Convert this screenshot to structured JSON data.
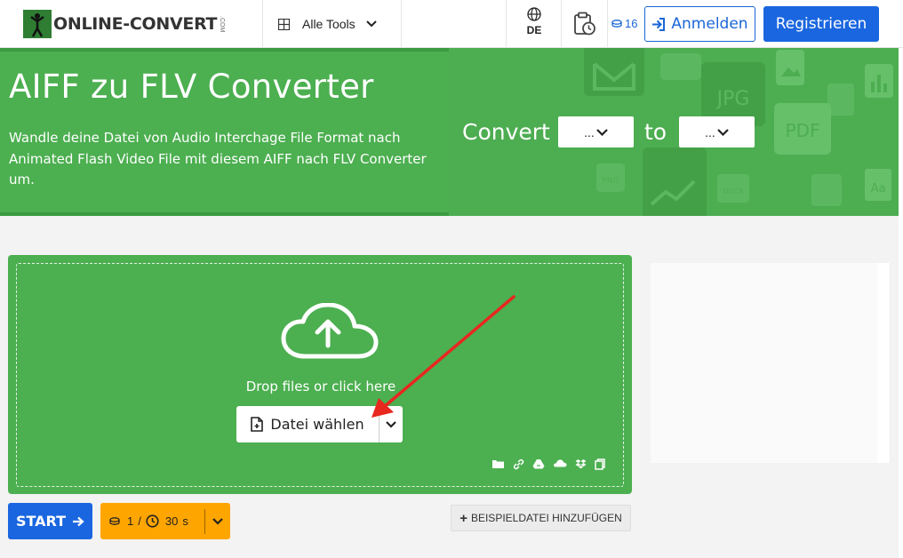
{
  "header": {
    "logo_text": "ONLINE-CONVERT",
    "logo_suffix": ".COM",
    "all_tools_label": "Alle Tools",
    "language": "DE",
    "credits_count": "16",
    "login_label": "Anmelden",
    "register_label": "Registrieren"
  },
  "hero": {
    "title": "AIFF zu FLV Converter",
    "description": "Wandle deine Datei von Audio Interchage File Format nach Animated Flash Video File mit diesem AIFF nach FLV Converter um.",
    "convert_label": "Convert",
    "to_label": "to",
    "from_select_value": "...",
    "to_select_value": "...",
    "bg_icons": [
      "JPG",
      "PDF",
      "PNG",
      "DOCX",
      "Aa"
    ]
  },
  "upload": {
    "drop_text": "Drop files or click here",
    "choose_label": "Datei wählen",
    "sources": [
      "folder-icon",
      "link-icon",
      "google-drive-icon",
      "onedrive-icon",
      "dropbox-icon",
      "clipboard-icon"
    ]
  },
  "actions": {
    "start_label": "START",
    "credit_cost": "1",
    "separator": "/",
    "time_value": "30",
    "time_unit": "s",
    "sample_label": "BEISPIELDATEI HINZUFÜGEN"
  },
  "colors": {
    "brand_green": "#4caf50",
    "primary_blue": "#1a66e0",
    "credit_orange": "#ffa500",
    "annotation_red": "#e8271f"
  }
}
